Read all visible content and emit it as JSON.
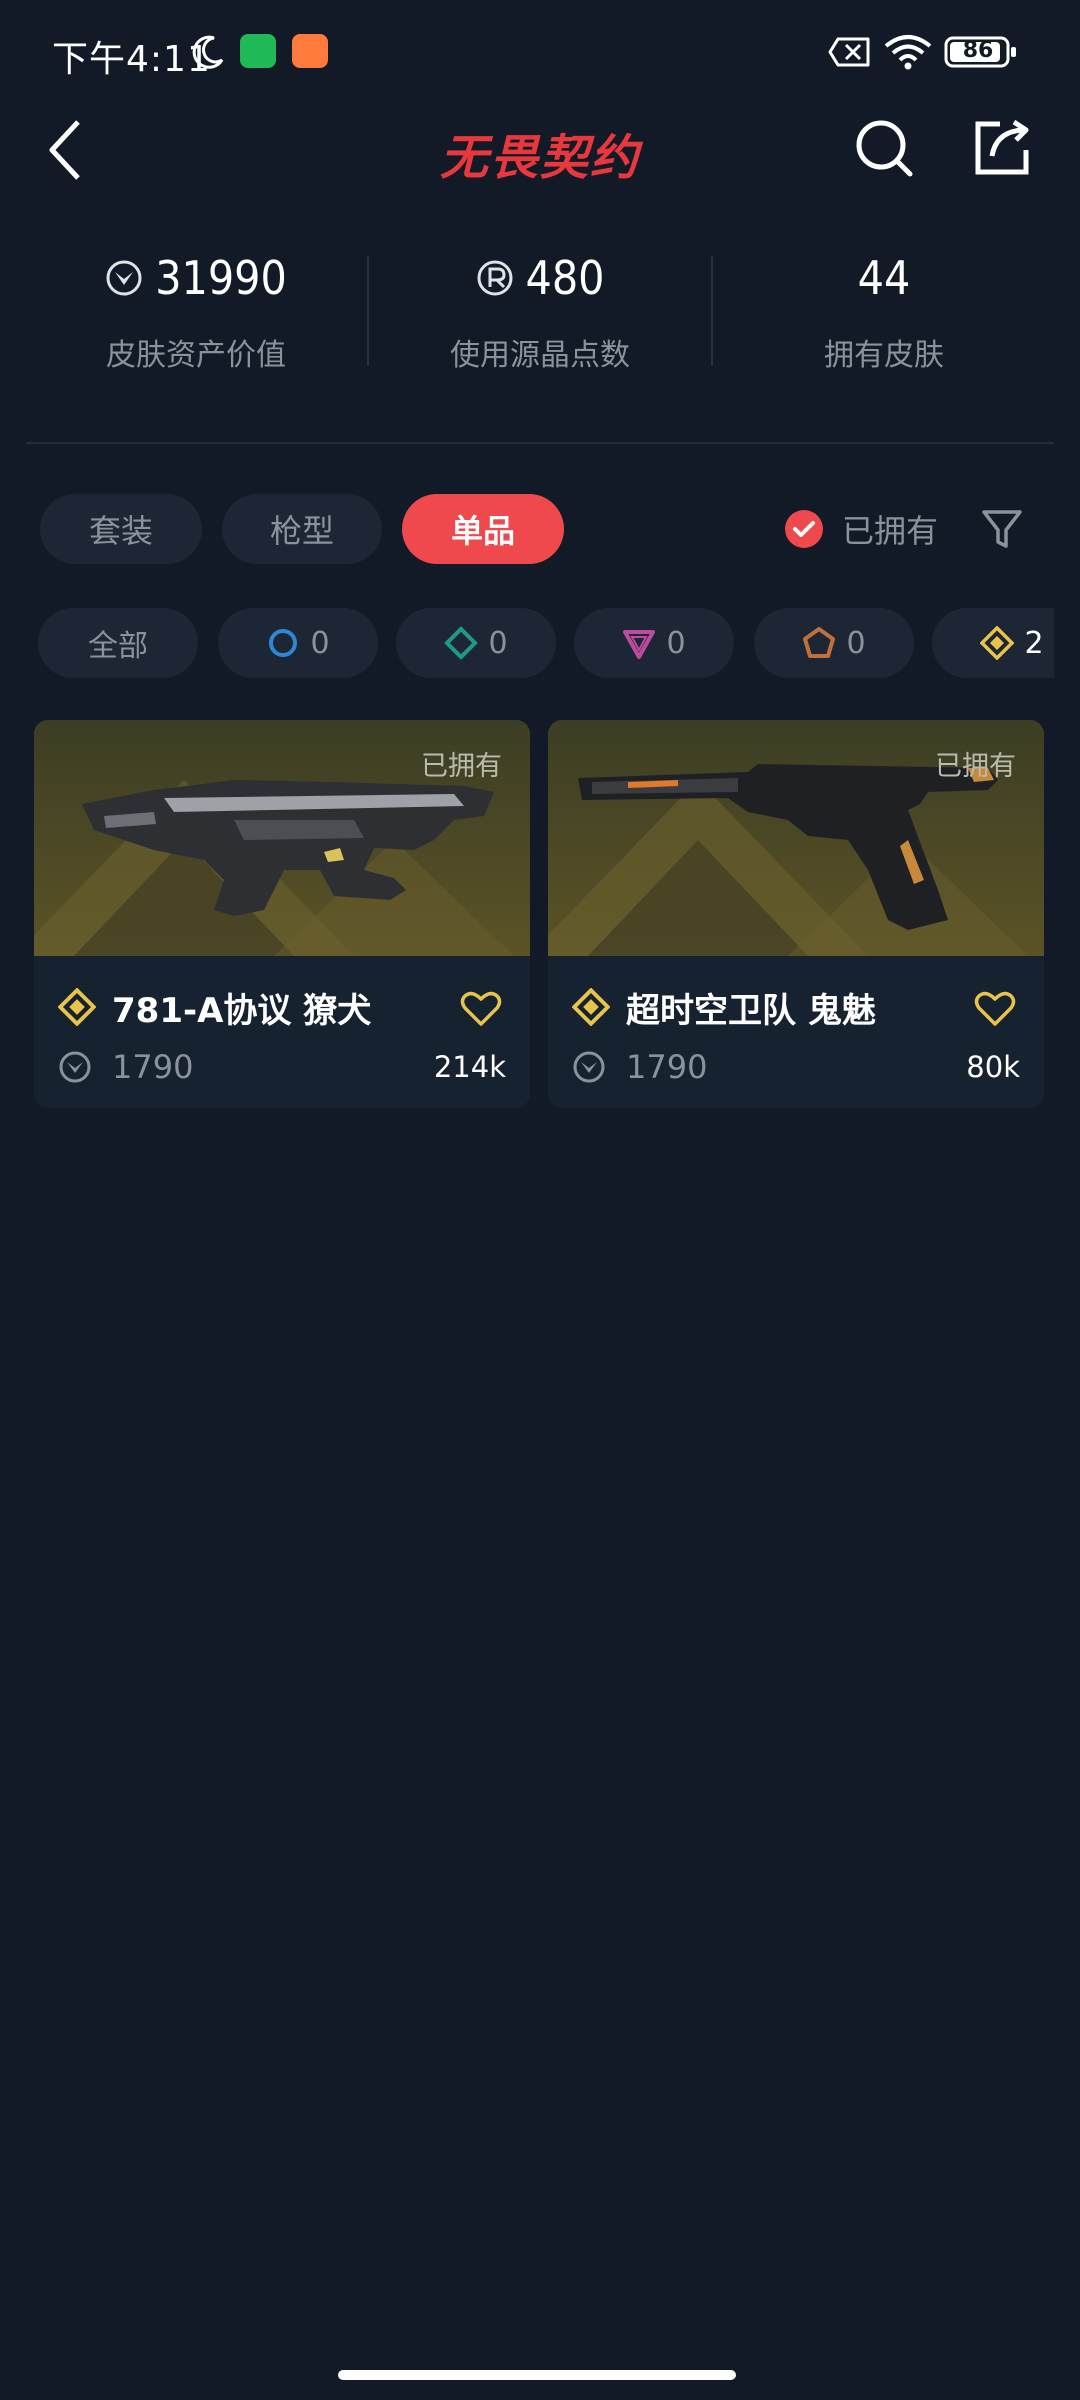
{
  "status_bar": {
    "time": "下午4:11",
    "battery": "86"
  },
  "header": {
    "title": "无畏契约"
  },
  "stats": [
    {
      "value": "31990",
      "label": "皮肤资产价值",
      "icon": "vp-currency-icon"
    },
    {
      "value": "480",
      "label": "使用源晶点数",
      "icon": "radianite-icon"
    },
    {
      "value": "44",
      "label": "拥有皮肤"
    }
  ],
  "tabs": [
    {
      "label": "套装",
      "active": false
    },
    {
      "label": "枪型",
      "active": false
    },
    {
      "label": "单品",
      "active": true
    }
  ],
  "owned_filter": {
    "label": "已拥有",
    "checked": true
  },
  "rarity_chips": [
    {
      "label": "全部"
    },
    {
      "count": "0",
      "tier": "select",
      "color": "#2f86d6"
    },
    {
      "count": "0",
      "tier": "deluxe",
      "color": "#1f9a8a"
    },
    {
      "count": "0",
      "tier": "premium",
      "color": "#c04aa0"
    },
    {
      "count": "0",
      "tier": "exclusive",
      "color": "#c0703a"
    },
    {
      "count": "2",
      "tier": "ultra",
      "color": "#e8c44a"
    }
  ],
  "cards": [
    {
      "name": "781-A协议 獠犬",
      "owned_label": "已拥有",
      "price": "1790",
      "likes": "214k"
    },
    {
      "name": "超时空卫队 鬼魅",
      "owned_label": "已拥有",
      "price": "1790",
      "likes": "80k"
    }
  ],
  "colors": {
    "background": "#111a26",
    "accent": "#f0494d",
    "ultra_gold": "#e8c44a"
  }
}
